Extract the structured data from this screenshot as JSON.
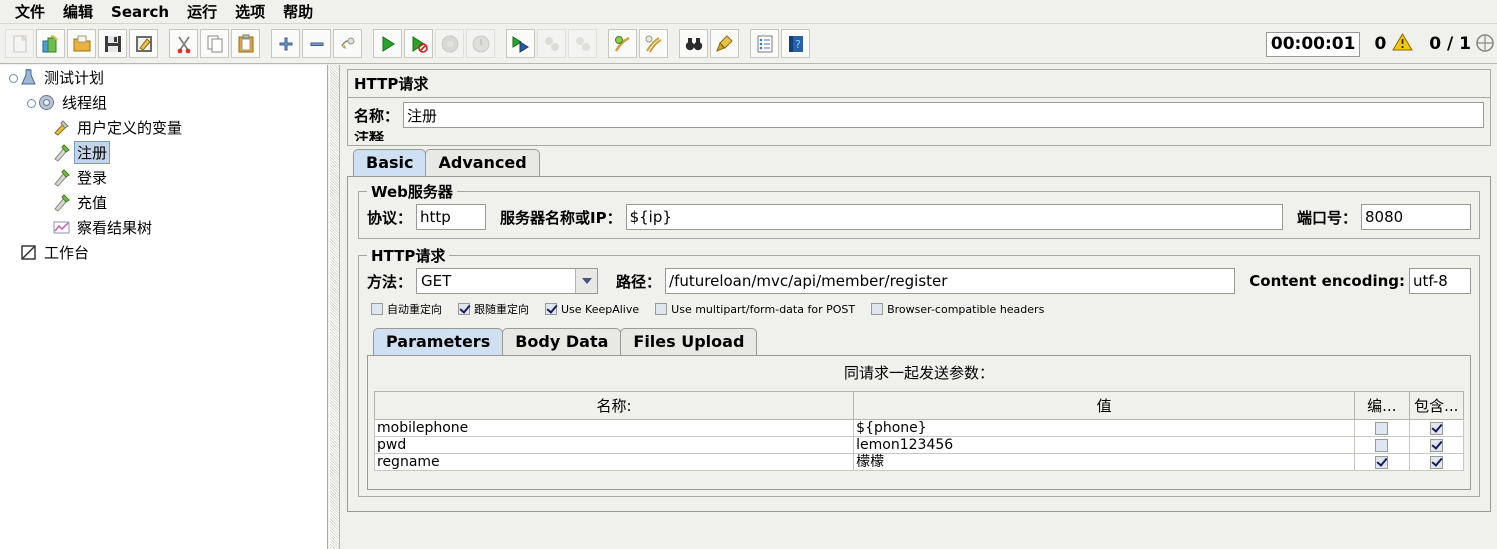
{
  "menu": {
    "items": [
      {
        "label": "文件",
        "name": "menu-file"
      },
      {
        "label": "编辑",
        "name": "menu-edit"
      },
      {
        "label": "Search",
        "name": "menu-search"
      },
      {
        "label": "运行",
        "name": "menu-run"
      },
      {
        "label": "选项",
        "name": "menu-options"
      },
      {
        "label": "帮助",
        "name": "menu-help"
      }
    ]
  },
  "toolbar": {
    "buttons": [
      {
        "icon": "new-document-icon",
        "disabled": true
      },
      {
        "icon": "templates-icon",
        "disabled": false
      },
      {
        "icon": "open-folder-icon",
        "disabled": false
      },
      {
        "icon": "save-icon",
        "disabled": false
      },
      {
        "icon": "save-as-icon",
        "disabled": false
      },
      {
        "icon": "cut-scissors-icon",
        "disabled": false
      },
      {
        "icon": "copy-icon",
        "disabled": false
      },
      {
        "icon": "paste-clipboard-icon",
        "disabled": false
      },
      {
        "icon": "expand-all-plus-icon",
        "disabled": false
      },
      {
        "icon": "collapse-all-minus-icon",
        "disabled": false
      },
      {
        "icon": "toggle-icon",
        "disabled": false
      },
      {
        "icon": "start-play-icon",
        "disabled": false
      },
      {
        "icon": "start-no-pauses-icon",
        "disabled": false
      },
      {
        "icon": "stop-icon",
        "disabled": true
      },
      {
        "icon": "shutdown-icon",
        "disabled": true
      },
      {
        "icon": "start-remote-all-icon",
        "disabled": false
      },
      {
        "icon": "stop-remote-all-icon",
        "disabled": true
      },
      {
        "icon": "shutdown-remote-all-icon",
        "disabled": true
      },
      {
        "icon": "clear-icon",
        "disabled": false
      },
      {
        "icon": "clear-all-icon",
        "disabled": false
      },
      {
        "icon": "search-binoculars-icon",
        "disabled": false
      },
      {
        "icon": "reset-search-broom-icon",
        "disabled": false
      },
      {
        "icon": "function-helper-icon",
        "disabled": false
      },
      {
        "icon": "help-book-icon",
        "disabled": false
      }
    ]
  },
  "status": {
    "timer": "00:00:01",
    "warning_count": "0",
    "warning_icon": "warning-triangle-icon",
    "threads": "0 / 1",
    "remote_icon": "remote-status-icon"
  },
  "tree": {
    "nodes": [
      {
        "label": "测试计划",
        "icon": "test-plan-icon",
        "indent": 0,
        "handle": true,
        "selected": false
      },
      {
        "label": "线程组",
        "icon": "thread-group-icon",
        "indent": 1,
        "handle": true,
        "selected": false
      },
      {
        "label": "用户定义的变量",
        "icon": "user-variables-icon",
        "indent": 2,
        "handle": false,
        "selected": false
      },
      {
        "label": "注册",
        "icon": "http-sampler-icon",
        "indent": 2,
        "handle": false,
        "selected": true
      },
      {
        "label": "登录",
        "icon": "http-sampler-icon",
        "indent": 2,
        "handle": false,
        "selected": false
      },
      {
        "label": "充值",
        "icon": "http-sampler-icon",
        "indent": 2,
        "handle": false,
        "selected": false
      },
      {
        "label": "察看结果树",
        "icon": "view-results-tree-icon",
        "indent": 2,
        "handle": false,
        "selected": false
      },
      {
        "label": "工作台",
        "icon": "workbench-icon",
        "indent": 0,
        "handle": false,
        "selected": false
      }
    ]
  },
  "panel": {
    "title": "HTTP请求",
    "name_label": "名称：",
    "name_value": "注册",
    "comment_label": "注释",
    "tabs": [
      {
        "label": "Basic",
        "active": true
      },
      {
        "label": "Advanced",
        "active": false
      }
    ],
    "web_server": {
      "group_title": "Web服务器",
      "protocol_label": "协议：",
      "protocol_value": "http",
      "server_label": "服务器名称或IP：",
      "server_value": "${ip}",
      "port_label": "端口号：",
      "port_value": "8080"
    },
    "http_request": {
      "group_title": "HTTP请求",
      "method_label": "方法：",
      "method_value": "GET",
      "path_label": "路径：",
      "path_value": "/futureloan/mvc/api/member/register",
      "encoding_label": "Content encoding:",
      "encoding_value": "utf-8",
      "checkboxes": [
        {
          "label": "自动重定向",
          "checked": false
        },
        {
          "label": "跟随重定向",
          "checked": true
        },
        {
          "label": "Use KeepAlive",
          "checked": true
        },
        {
          "label": "Use multipart/form-data for POST",
          "checked": false
        },
        {
          "label": "Browser-compatible headers",
          "checked": false
        }
      ],
      "param_tabs": [
        {
          "label": "Parameters",
          "active": true
        },
        {
          "label": "Body Data",
          "active": false
        },
        {
          "label": "Files Upload",
          "active": false
        }
      ],
      "params_title": "同请求一起发送参数：",
      "columns": [
        "名称:",
        "值",
        "编...",
        "包含..."
      ],
      "rows": [
        {
          "name": "mobilephone",
          "value": "${phone}",
          "encode": false,
          "include": true
        },
        {
          "name": "pwd",
          "value": "lemon123456",
          "encode": false,
          "include": true
        },
        {
          "name": "regname",
          "value": "檬檬",
          "encode": true,
          "include": true
        }
      ]
    }
  },
  "colors": {
    "bg": "#f0f0ed",
    "selection": "#c3d5ea",
    "tab_active": "#cfe0f2",
    "field_bg": "#ffffff",
    "border": "#9a9a95"
  }
}
